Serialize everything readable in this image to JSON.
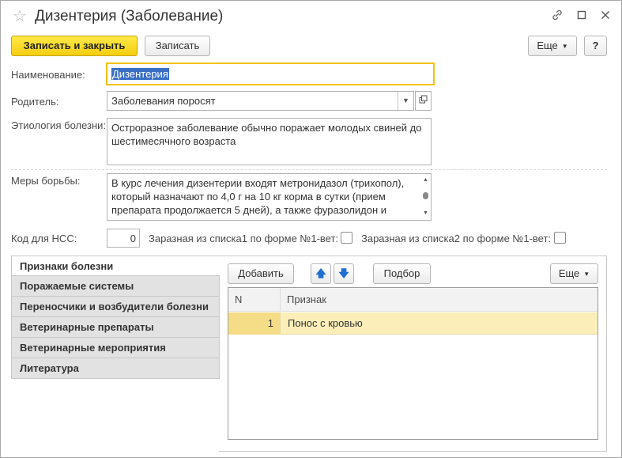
{
  "window": {
    "title": "Дизентерия (Заболевание)",
    "icons": [
      "star-icon",
      "link-icon",
      "maximize-icon",
      "close-icon"
    ]
  },
  "toolbar": {
    "save_close": "Записать и закрыть",
    "save": "Записать",
    "more": "Еще",
    "help": "?"
  },
  "form": {
    "name_label": "Наименование:",
    "name_value": "Дизентерия",
    "parent_label": "Родитель:",
    "parent_value": "Заболевания поросят",
    "etiology_label": "Этиология болезни:",
    "etiology_value": "Остроразное заболевание обычно поражает молодых свиней до шестимесячного возраста",
    "measures_label": "Меры борьбы:",
    "measures_value": "В курс лечения дизентерии входят метронидазол (трихопол), который назначают по 4,0 г на 10 кг корма в сутки (прием препарата продолжается 5 дней), а также фуразолидон и",
    "code_label": "Код для НСС:",
    "code_value": "0",
    "contagious1_label": "Заразная из списка1 по форме №1-вет:",
    "contagious2_label": "Заразная из списка2 по форме №1-вет:"
  },
  "tabs": [
    {
      "label": "Признаки болезни",
      "active": true
    },
    {
      "label": "Поражаемые системы",
      "active": false
    },
    {
      "label": "Переносчики и возбудители болезни",
      "active": false
    },
    {
      "label": "Ветеринарные препараты",
      "active": false
    },
    {
      "label": "Ветеринарные мероприятия",
      "active": false
    },
    {
      "label": "Литература",
      "active": false
    }
  ],
  "tab_toolbar": {
    "add": "Добавить",
    "pick": "Подбор",
    "more": "Еще"
  },
  "grid": {
    "columns": [
      "N",
      "Признак"
    ],
    "rows": [
      {
        "n": "1",
        "sign": "Понос с кровью"
      }
    ]
  },
  "colors": {
    "accent_yellow": "#f5cd0f",
    "focus_border": "#f2c317",
    "selected_row": "#fbeeb8",
    "selection": "#3a6fc6"
  }
}
